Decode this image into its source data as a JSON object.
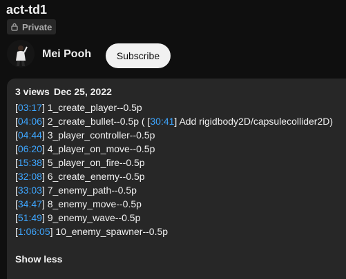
{
  "video": {
    "title": "act-td1",
    "privacy_label": "Private",
    "privacy_icon": "lock-icon"
  },
  "channel": {
    "name": "Mei Pooh",
    "subscribe_label": "Subscribe"
  },
  "description": {
    "views": "3 views",
    "date": "Dec 25, 2022",
    "chapters": [
      {
        "timestamp": "03:17",
        "text": "1_create_player--0.5p"
      },
      {
        "timestamp": "04:06",
        "text": "2_create_bullet--0.5p (",
        "timestamp2": "30:41",
        "text2": "Add rigidbody2D/capsulecollider2D)"
      },
      {
        "timestamp": "04:44",
        "text": "3_player_controller--0.5p"
      },
      {
        "timestamp": "06:20",
        "text": "4_player_on_move--0.5p"
      },
      {
        "timestamp": "15:38",
        "text": "5_player_on_fire--0.5p"
      },
      {
        "timestamp": "32:08",
        "text": "6_create_enemy--0.5p"
      },
      {
        "timestamp": "33:03",
        "text": "7_enemy_path--0.5p"
      },
      {
        "timestamp": "34:47",
        "text": "8_enemy_move--0.5p"
      },
      {
        "timestamp": "51:49",
        "text": "9_enemy_wave--0.5p"
      },
      {
        "timestamp": "1:06:05",
        "text": "10_enemy_spawner--0.5p"
      }
    ],
    "show_less_label": "Show less"
  },
  "colors": {
    "background": "#0f0f0f",
    "panel": "#272727",
    "link": "#3ea6ff",
    "text": "#f1f1f1"
  }
}
